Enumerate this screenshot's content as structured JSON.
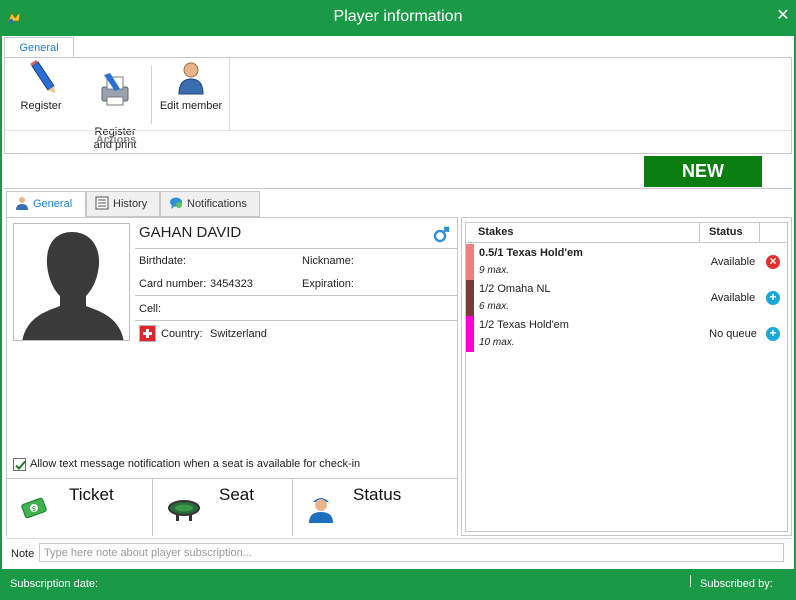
{
  "window": {
    "title": "Player information"
  },
  "ribbon": {
    "tab_label": "General",
    "buttons": [
      {
        "label": "Register",
        "icon": "pencil-icon"
      },
      {
        "label": "Register\nand print",
        "icon": "printer-icon"
      },
      {
        "label": "Edit member",
        "icon": "user-icon"
      }
    ],
    "group_label": "Actions"
  },
  "badge": {
    "label": "NEW",
    "color": "#0b7e12"
  },
  "tabs": [
    {
      "label": "General",
      "icon": "user-icon",
      "active": true
    },
    {
      "label": "History",
      "icon": "list-icon",
      "active": false
    },
    {
      "label": "Notifications",
      "icon": "chat-icon",
      "active": false
    }
  ],
  "player": {
    "name": "GAHAN DAVID",
    "gender_icon": "male-icon",
    "birthdate_label": "Birthdate:",
    "birthdate": "",
    "nickname_label": "Nickname:",
    "nickname": "",
    "card_label": "Card number:",
    "card_number": "3454323",
    "expiration_label": "Expiration:",
    "expiration": "",
    "cell_label": "Cell:",
    "cell": "",
    "country_label": "Country:",
    "country": "Switzerland",
    "country_flag": "swiss-flag-icon"
  },
  "sms_option": {
    "label": "Allow text message notification when a seat is available for check-in",
    "checked": true
  },
  "actions": [
    {
      "label": "Ticket",
      "icon": "ticket-icon"
    },
    {
      "label": "Seat",
      "icon": "poker-table-icon"
    },
    {
      "label": "Status",
      "icon": "person-cap-icon"
    }
  ],
  "stakes_table": {
    "headers": {
      "stakes": "Stakes",
      "status": "Status"
    },
    "rows": [
      {
        "stake": "0.5/1 Texas Hold'em",
        "max": "9 max.",
        "status": "Available",
        "color": "#f08080",
        "bold": true,
        "action": "remove",
        "action_color": "#e03030"
      },
      {
        "stake": "1/2 Omaha NL",
        "max": "6 max.",
        "status": "Available",
        "color": "#7a3b3b",
        "bold": false,
        "action": "add",
        "action_color": "#1aa8d8"
      },
      {
        "stake": "1/2 Texas Hold'em",
        "max": "10 max.",
        "status": "No queue",
        "color": "#ff00d8",
        "bold": false,
        "action": "add",
        "action_color": "#1aa8d8"
      }
    ]
  },
  "note": {
    "label": "Note",
    "placeholder": "Type here note about player subscription...",
    "value": ""
  },
  "status_bar": {
    "subscription_date": "Subscription date:",
    "subscribed_by": "Subscribed by:"
  },
  "colors": {
    "accent": "#1a9a46",
    "link": "#1a7fd0"
  }
}
